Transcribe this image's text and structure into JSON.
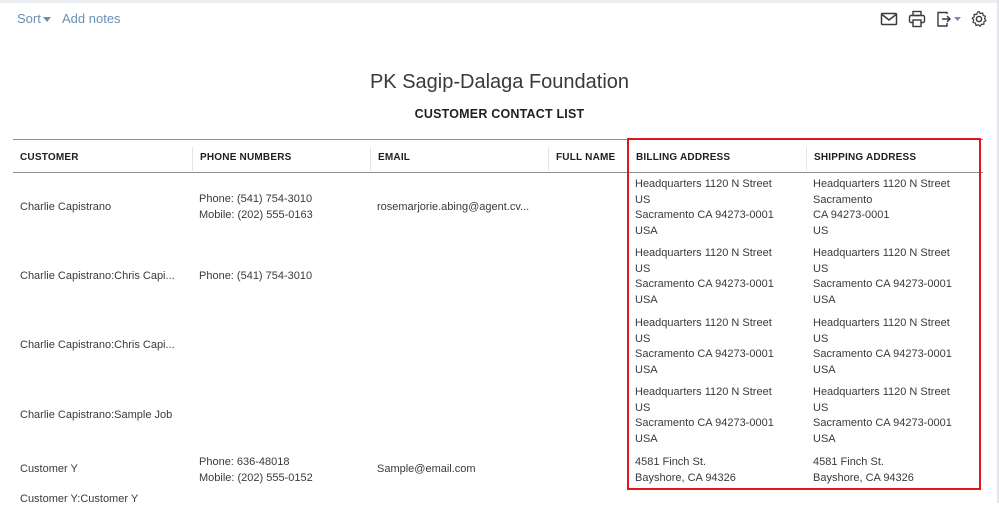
{
  "toolbar": {
    "sort_label": "Sort",
    "add_notes_label": "Add notes",
    "icons": [
      "mail-icon",
      "print-icon",
      "export-icon",
      "gear-icon"
    ]
  },
  "report": {
    "company": "PK Sagip-Dalaga Foundation",
    "title": "CUSTOMER CONTACT LIST"
  },
  "table": {
    "columns": [
      "CUSTOMER",
      "PHONE NUMBERS",
      "EMAIL",
      "FULL NAME",
      "BILLING ADDRESS",
      "SHIPPING ADDRESS"
    ],
    "rows": [
      {
        "customer": "Charlie Capistrano",
        "phone": [
          "Phone: (541) 754-3010",
          "Mobile: (202) 555-0163"
        ],
        "email": "rosemarjorie.abing@agent.cv...",
        "full_name": "",
        "billing": [
          "Headquarters 1120 N Street",
          "US",
          "Sacramento CA 94273-0001",
          "USA"
        ],
        "shipping": [
          "Headquarters 1120 N Street",
          "Sacramento",
          "CA 94273-0001",
          "US"
        ]
      },
      {
        "customer": "Charlie Capistrano:Chris Capi...",
        "phone": [
          "Phone: (541) 754-3010"
        ],
        "email": "",
        "full_name": "",
        "billing": [
          "Headquarters 1120 N Street",
          "US",
          "Sacramento CA 94273-0001",
          "USA"
        ],
        "shipping": [
          "Headquarters 1120 N Street",
          "US",
          "Sacramento CA 94273-0001",
          "USA"
        ]
      },
      {
        "customer": "Charlie Capistrano:Chris Capi...",
        "phone": [],
        "email": "",
        "full_name": "",
        "billing": [
          "Headquarters 1120 N Street",
          "US",
          "Sacramento CA 94273-0001",
          "USA"
        ],
        "shipping": [
          "Headquarters 1120 N Street",
          "US",
          "Sacramento CA 94273-0001",
          "USA"
        ]
      },
      {
        "customer": "Charlie Capistrano:Sample Job",
        "phone": [],
        "email": "",
        "full_name": "",
        "billing": [
          "Headquarters 1120 N Street",
          "US",
          "Sacramento CA 94273-0001",
          "USA"
        ],
        "shipping": [
          "Headquarters 1120 N Street",
          "US",
          "Sacramento CA 94273-0001",
          "USA"
        ]
      },
      {
        "customer": "Customer Y",
        "phone": [
          "Phone: 636-48018",
          "Mobile: (202) 555-0152"
        ],
        "email": "Sample@email.com",
        "full_name": "",
        "billing": [
          "4581 Finch St.",
          "Bayshore, CA 94326"
        ],
        "shipping": [
          "4581 Finch St.",
          "Bayshore, CA 94326"
        ]
      },
      {
        "customer": "Customer Y:Customer Y",
        "phone": [],
        "email": "",
        "full_name": "",
        "billing": [],
        "shipping": []
      }
    ]
  },
  "highlight_color": "#e0161d",
  "link_color": "#6b8fb3"
}
